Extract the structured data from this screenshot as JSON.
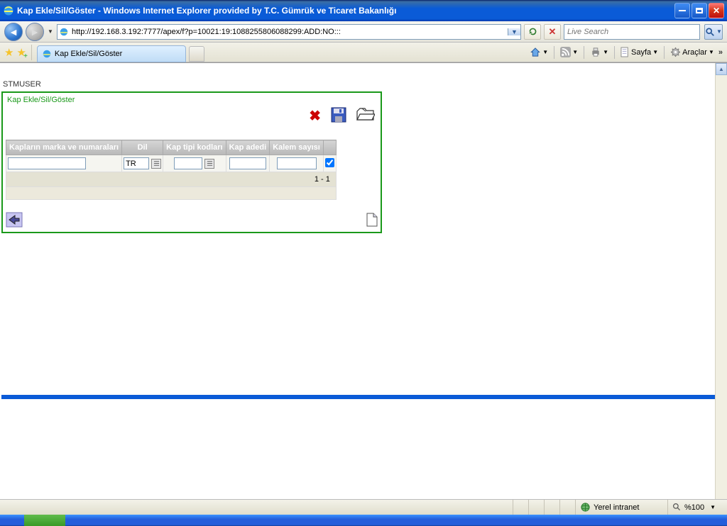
{
  "window": {
    "title": "Kap Ekle/Sil/Göster - Windows Internet Explorer provided by T.C. Gümrük ve Ticaret Bakanlığı"
  },
  "navbar": {
    "url": "http://192.168.3.192:7777/apex/f?p=10021:19:1088255806088299:ADD:NO:::",
    "search_placeholder": "Live Search"
  },
  "favbar": {
    "tab_label": "Kap Ekle/Sil/Göster",
    "sayfa_label": "Sayfa",
    "araclar_label": "Araçlar"
  },
  "page": {
    "username": "STMUSER",
    "panel_title": "Kap Ekle/Sil/Göster",
    "columns": {
      "c1": "Kapların marka ve numaraları",
      "c2": "Dil",
      "c3": "Kap tipi kodları",
      "c4": "Kap adedi",
      "c5": "Kalem sayısı"
    },
    "row": {
      "marka": "",
      "dil": "TR",
      "tip": "",
      "adedi": "",
      "kalem": ""
    },
    "pager": "1 - 1"
  },
  "statusbar": {
    "zone": "Yerel intranet",
    "zoom": "%100"
  }
}
